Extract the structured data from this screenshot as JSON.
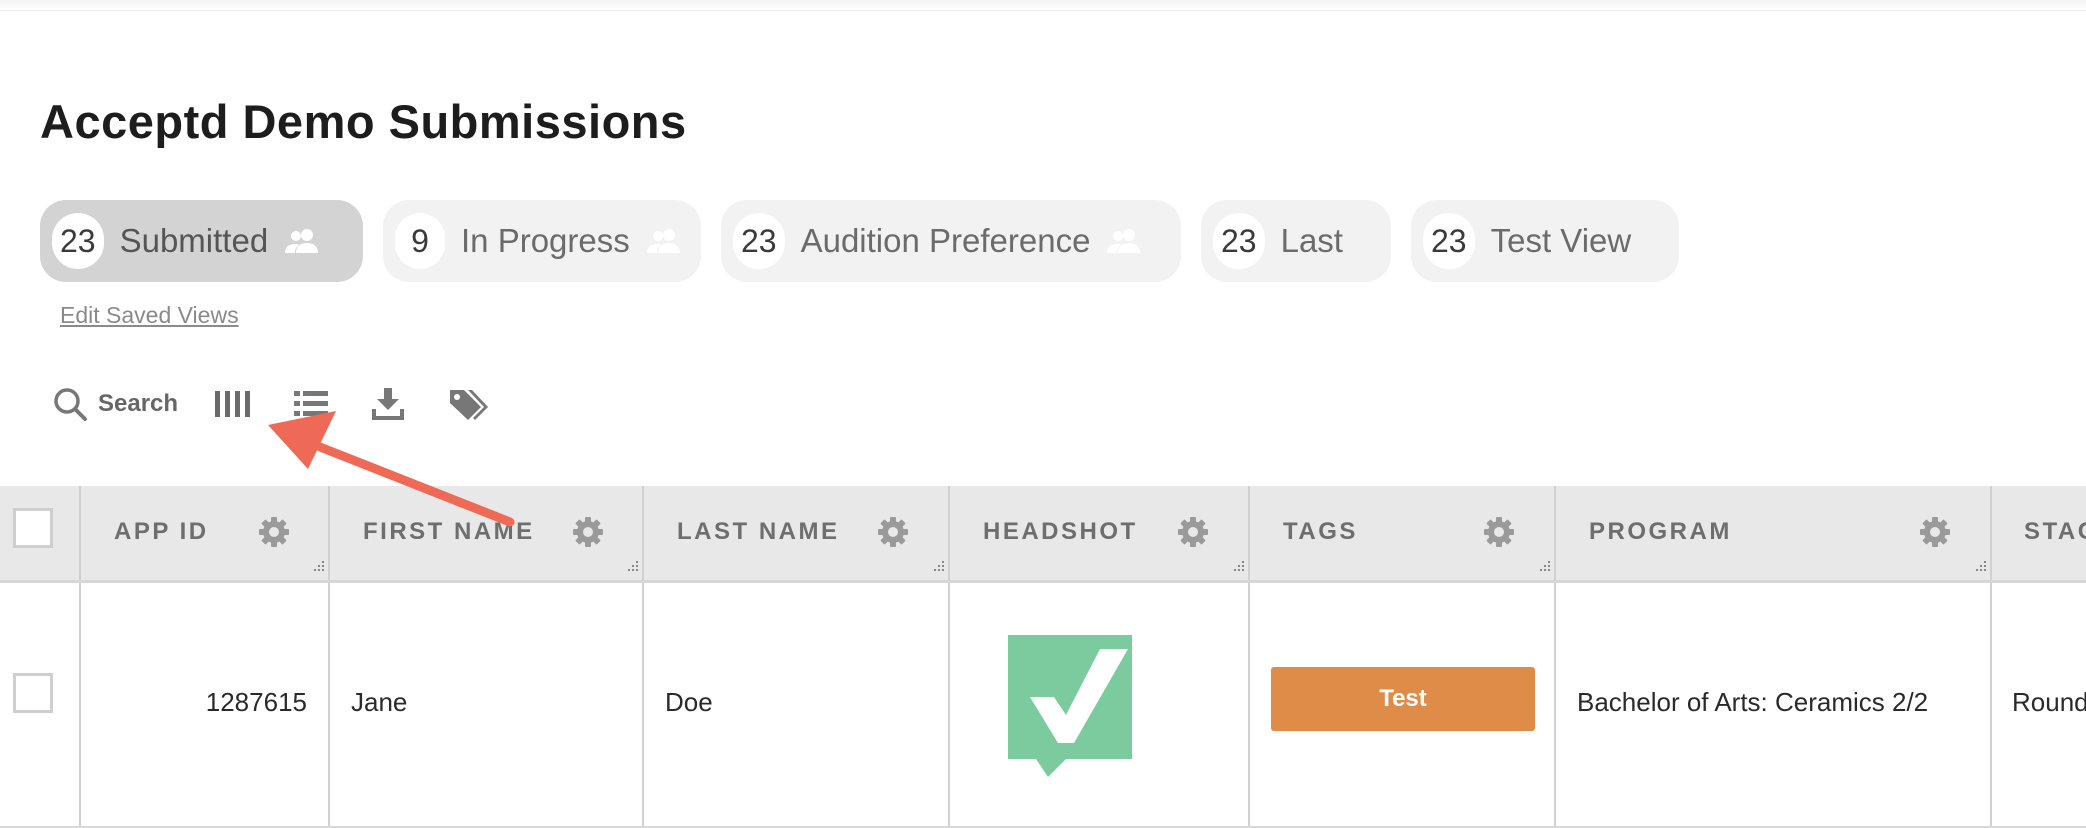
{
  "page": {
    "title": "Acceptd Demo Submissions"
  },
  "views": [
    {
      "count": "23",
      "label": "Submitted",
      "icon": "users-icon",
      "active": true
    },
    {
      "count": "9",
      "label": "In Progress",
      "icon": "users-icon",
      "active": false
    },
    {
      "count": "23",
      "label": "Audition Preference",
      "icon": "users-icon",
      "active": false
    },
    {
      "count": "23",
      "label": "Last",
      "icon": null,
      "active": false
    },
    {
      "count": "23",
      "label": "Test View",
      "icon": null,
      "active": false
    }
  ],
  "edit_views_label": "Edit Saved Views",
  "toolbar": {
    "search_label": "Search",
    "icons": [
      "search-icon",
      "columns-icon",
      "list-icon",
      "download-icon",
      "tag-icon"
    ]
  },
  "table": {
    "columns": [
      "APP ID",
      "FIRST NAME",
      "LAST NAME",
      "HEADSHOT",
      "TAGS",
      "PROGRAM",
      "STAGE"
    ],
    "rows": [
      {
        "app_id": "1287615",
        "first_name": "Jane",
        "last_name": "Doe",
        "headshot": "acceptd-logo",
        "tag": "Test",
        "program": "Bachelor of Arts: Ceramics 2/2",
        "stage": "Round"
      }
    ]
  },
  "colors": {
    "tag": "#df8c49",
    "annotation_arrow": "#ee6a56",
    "logo_green": "#7ccb9f"
  }
}
